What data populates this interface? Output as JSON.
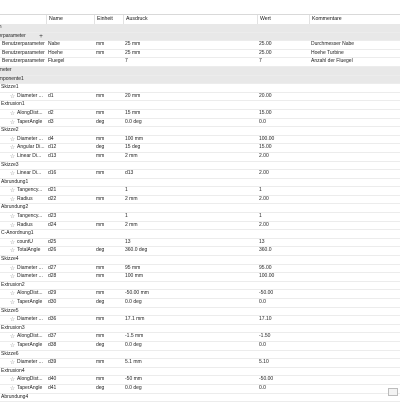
{
  "columns": [
    "ter",
    "Name",
    "Einheit",
    "Ausdruck",
    "Wert",
    "Kommentare"
  ],
  "rows": [
    {
      "kind": "section",
      "label": "en"
    },
    {
      "kind": "section",
      "label": "zerparameter",
      "plus": true
    },
    {
      "kind": "param",
      "label": "Benutzerparameter",
      "name": "Nabe",
      "unit": "mm",
      "expr": "25 mm",
      "value": "25.00",
      "comment": "Durchmesser Nabe"
    },
    {
      "kind": "param",
      "label": "Benutzerparameter",
      "name": "Hoehe",
      "unit": "mm",
      "expr": "25 mm",
      "value": "25.00",
      "comment": "Hoehe Turbine"
    },
    {
      "kind": "param",
      "label": "Benutzerparameter",
      "name": "Fluegel",
      "unit": "",
      "expr": "7",
      "value": "7",
      "comment": "Anzahl der Fluegel"
    },
    {
      "kind": "section",
      "label": "ameter"
    },
    {
      "kind": "section",
      "label": "omponente1"
    },
    {
      "kind": "group",
      "label": "Skizze1"
    },
    {
      "kind": "item",
      "label": "Diameter ...",
      "name": "d1",
      "unit": "mm",
      "expr": "20 mm",
      "value": "20.00",
      "comment": ""
    },
    {
      "kind": "group",
      "label": "Extrusion1"
    },
    {
      "kind": "item",
      "label": "AlongDist...",
      "name": "d2",
      "unit": "mm",
      "expr": "15 mm",
      "value": "15.00",
      "comment": ""
    },
    {
      "kind": "item",
      "label": "TaperAngle",
      "name": "d3",
      "unit": "deg",
      "expr": "0.0 deg",
      "value": "0.0",
      "comment": ""
    },
    {
      "kind": "group",
      "label": "Skizze2"
    },
    {
      "kind": "item",
      "label": "Diameter ...",
      "name": "d4",
      "unit": "mm",
      "expr": "100 mm",
      "value": "100.00",
      "comment": ""
    },
    {
      "kind": "item",
      "label": "Angular Di...",
      "name": "d12",
      "unit": "deg",
      "expr": "15 deg",
      "value": "15.00",
      "comment": ""
    },
    {
      "kind": "item",
      "label": "Linear Di...",
      "name": "d13",
      "unit": "mm",
      "expr": "2 mm",
      "value": "2.00",
      "comment": ""
    },
    {
      "kind": "group",
      "label": "Skizze3"
    },
    {
      "kind": "item",
      "label": "Linear Di...",
      "name": "d16",
      "unit": "mm",
      "expr": "d13",
      "value": "2.00",
      "comment": ""
    },
    {
      "kind": "group",
      "label": "Abrundung1"
    },
    {
      "kind": "item",
      "label": "Tangency...",
      "name": "d21",
      "unit": "",
      "expr": "1",
      "value": "1",
      "comment": ""
    },
    {
      "kind": "item",
      "label": "Radius",
      "name": "d22",
      "unit": "mm",
      "expr": "2 mm",
      "value": "2.00",
      "comment": ""
    },
    {
      "kind": "group",
      "label": "Abrundung2"
    },
    {
      "kind": "item",
      "label": "Tangency...",
      "name": "d23",
      "unit": "",
      "expr": "1",
      "value": "1",
      "comment": ""
    },
    {
      "kind": "item",
      "label": "Radius",
      "name": "d24",
      "unit": "mm",
      "expr": "2 mm",
      "value": "2.00",
      "comment": ""
    },
    {
      "kind": "group",
      "label": "C-Anordnung1"
    },
    {
      "kind": "item",
      "label": "countU",
      "name": "d25",
      "unit": "",
      "expr": "13",
      "value": "13",
      "comment": ""
    },
    {
      "kind": "item",
      "label": "TotalAngle",
      "name": "d26",
      "unit": "deg",
      "expr": "360.0 deg",
      "value": "360.0",
      "comment": ""
    },
    {
      "kind": "group",
      "label": "Skizze4"
    },
    {
      "kind": "item",
      "label": "Diameter ...",
      "name": "d27",
      "unit": "mm",
      "expr": "95 mm",
      "value": "95.00",
      "comment": ""
    },
    {
      "kind": "item",
      "label": "Diameter ...",
      "name": "d28",
      "unit": "mm",
      "expr": "100 mm",
      "value": "100.00",
      "comment": ""
    },
    {
      "kind": "group",
      "label": "Extrusion2"
    },
    {
      "kind": "item",
      "label": "AlongDist...",
      "name": "d29",
      "unit": "mm",
      "expr": "-50.00 mm",
      "value": "-50.00",
      "comment": ""
    },
    {
      "kind": "item",
      "label": "TaperAngle",
      "name": "d30",
      "unit": "deg",
      "expr": "0.0 deg",
      "value": "0.0",
      "comment": ""
    },
    {
      "kind": "group",
      "label": "Skizze5"
    },
    {
      "kind": "item",
      "label": "Diameter ...",
      "name": "d36",
      "unit": "mm",
      "expr": "17.1 mm",
      "value": "17.10",
      "comment": ""
    },
    {
      "kind": "group",
      "label": "Extrusion3"
    },
    {
      "kind": "item",
      "label": "AlongDist...",
      "name": "d37",
      "unit": "mm",
      "expr": "-1.5 mm",
      "value": "-1.50",
      "comment": ""
    },
    {
      "kind": "item",
      "label": "TaperAngle",
      "name": "d38",
      "unit": "deg",
      "expr": "0.0 deg",
      "value": "0.0",
      "comment": ""
    },
    {
      "kind": "group",
      "label": "Skizze6"
    },
    {
      "kind": "item",
      "label": "Diameter ...",
      "name": "d39",
      "unit": "mm",
      "expr": "5.1 mm",
      "value": "5.10",
      "comment": ""
    },
    {
      "kind": "group",
      "label": "Extrusion4"
    },
    {
      "kind": "item",
      "label": "AlongDist...",
      "name": "d40",
      "unit": "mm",
      "expr": "-50 mm",
      "value": "-50.00",
      "comment": ""
    },
    {
      "kind": "item",
      "label": "TaperAngle",
      "name": "d41",
      "unit": "deg",
      "expr": "0.0 deg",
      "value": "0.0",
      "comment": ""
    },
    {
      "kind": "group",
      "label": "Abrundung4"
    }
  ],
  "icons": {
    "favorite": "star-outline-icon",
    "add": "plus-icon"
  },
  "colors": {
    "section_bg": "#e8e8e8",
    "grid_line": "#ececec",
    "header_border": "#d9d9d9",
    "star": "#8a8a8a"
  }
}
